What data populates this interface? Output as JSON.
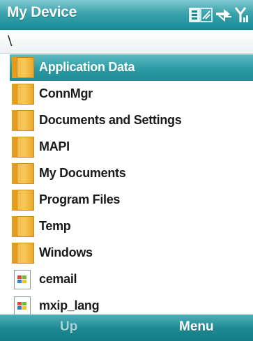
{
  "title": "My Device",
  "status_icons": [
    "battery-icon",
    "connectivity-icon",
    "signal-strength-icon"
  ],
  "path": "\\",
  "items": [
    {
      "label": "Application Data",
      "type": "folder",
      "selected": true
    },
    {
      "label": "ConnMgr",
      "type": "folder"
    },
    {
      "label": "Documents and Settings",
      "type": "folder"
    },
    {
      "label": "MAPI",
      "type": "folder"
    },
    {
      "label": "My Documents",
      "type": "folder"
    },
    {
      "label": "Program Files",
      "type": "folder"
    },
    {
      "label": "Temp",
      "type": "folder"
    },
    {
      "label": "Windows",
      "type": "folder"
    },
    {
      "label": "cemail",
      "type": "file"
    },
    {
      "label": "mxip_lang",
      "type": "file"
    }
  ],
  "softkeys": {
    "left": "Up",
    "right": "Menu"
  },
  "colors": {
    "accent": "#2c9aa3",
    "folder": "#f3b43a"
  }
}
